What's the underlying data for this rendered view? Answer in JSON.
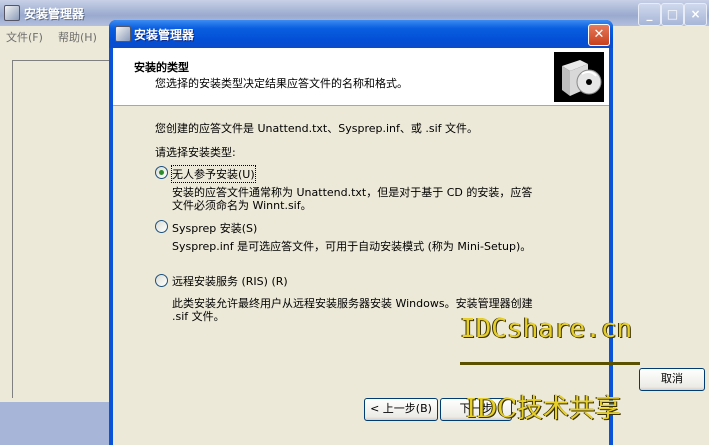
{
  "main_window": {
    "title": "安装管理器",
    "menu": [
      "文件(F)",
      "帮助(H)"
    ],
    "caption_buttons": [
      "minimize-icon",
      "maximize-icon",
      "close-icon"
    ]
  },
  "dialog": {
    "title": "安装管理器",
    "header": {
      "title": "安装的类型",
      "subtitle": "您选择的安装类型决定结果应答文件的名称和格式。"
    },
    "intro": "您创建的应答文件是 Unattend.txt、Sysprep.inf、或 .sif 文件。",
    "prompt": "请选择安装类型:",
    "options": [
      {
        "label": "无人参予安装(U)",
        "selected": true,
        "desc1": "安装的应答文件通常称为 Unattend.txt，但是对于基于 CD 的安装，应答",
        "desc2": "文件必须命名为 Winnt.sif。"
      },
      {
        "label": "Sysprep 安装(S)",
        "selected": false,
        "desc1": "Sysprep.inf 是可选应答文件，可用于自动安装模式 (称为 Mini-Setup)。",
        "desc2": ""
      },
      {
        "label": "远程安装服务 (RIS) (R)",
        "selected": false,
        "desc1": "此类安装允许最终用户从远程安装服务器安装 Windows。安装管理器创建",
        "desc2": ".sif 文件。"
      }
    ],
    "buttons": {
      "back": "< 上一步(B)",
      "next": "下一步",
      "cancel": "取消"
    },
    "close_icon": "close-icon",
    "header_icon": "setup-box-cd-icon"
  },
  "watermark": {
    "line1": "IDCshare.cn",
    "line2": "IDC技术共享"
  }
}
